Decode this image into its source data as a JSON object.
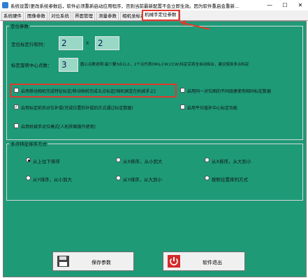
{
  "title_bar": {
    "text": "系统设置(更改系统参数后，软件必须重新启动应用程序，否则当前最新配置不会立即生效。因为软件重启会重新...",
    "minimize": "—",
    "maximize": "☐",
    "close": "✕"
  },
  "tabs": [
    {
      "label": "系统硬件"
    },
    {
      "label": "图像参数"
    },
    {
      "label": "对位系统"
    },
    {
      "label": "界面管理"
    },
    {
      "label": "测量参数"
    },
    {
      "label": "相机坐标系"
    },
    {
      "label": "机械手定位参数"
    }
  ],
  "calib_group": {
    "title": "定位参数",
    "rows_label": "定位标定行和列：",
    "rows_value": "2",
    "times_symbol": "X",
    "cols_value": "2",
    "center_label": "标定旋转中心点数：",
    "center_value": "3",
    "center_note": "圆心点数说明:最少要3点以上，2个点代表ORG,CW,CCW;标定完将全自动拟合，建议使用多点标定"
  },
  "options": {
    "opt1": "启用移动相机完成特征标定/移动相机完成五点标定[相机固定在机械手上]",
    "opt2": "启用同一对位图的不同组建使用相同标定数据",
    "opt3": "启用标定前后对位补偿(完成位置的补偿后正式通过标定数据)",
    "opt4": "启用平均值补中心标定功能",
    "opt5": "启用机械手对位模式[人机界面操作使用]"
  },
  "sort_group": {
    "title": "多点特征排序方式",
    "r1": "从上往下排序",
    "r2": "从X排序，从小到大",
    "r3": "从X排序，从大到小",
    "r4": "从Y排序，从小到大",
    "r5": "从Y排序，从大到小",
    "r6": "按照位置排列方式"
  },
  "buttons": {
    "save": "保存参数",
    "exit": "软件退出"
  },
  "colors": {
    "panel": "#1e9a77",
    "highlight": "#e0392b"
  }
}
